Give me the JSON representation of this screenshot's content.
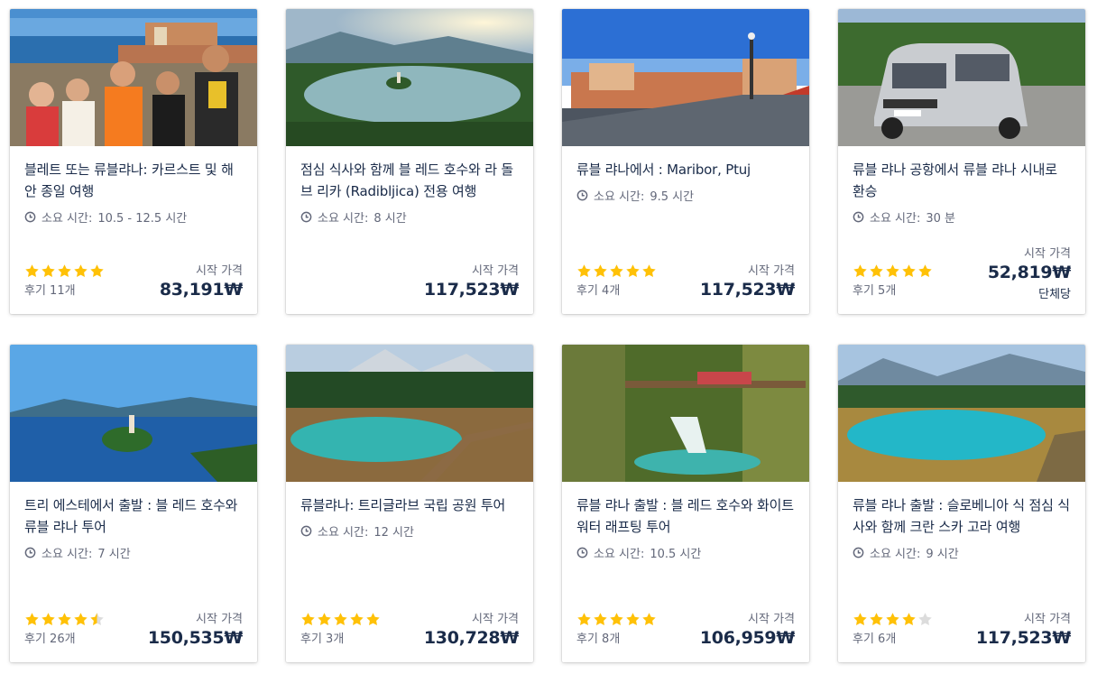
{
  "cards": [
    {
      "title": "블레트 또는 류블랴나: 카르스트 및 해안 종일 여행",
      "duration_label": "소요 시간:",
      "duration": "10.5 - 12.5 시간",
      "rating": 5,
      "reviews": "후기 11개",
      "price_from": "시작 가격",
      "price": "83,191₩",
      "price_unit": ""
    },
    {
      "title": "점심 식사와 함께 블 레드 호수와 라 돌브 리카 (Radibljica) 전용 여행",
      "duration_label": "소요 시간:",
      "duration": "8 시간",
      "rating": null,
      "reviews": "",
      "price_from": "시작 가격",
      "price": "117,523₩",
      "price_unit": ""
    },
    {
      "title": "류블 랴나에서 : Maribor, Ptuj",
      "duration_label": "소요 시간:",
      "duration": "9.5 시간",
      "rating": 5,
      "reviews": "후기 4개",
      "price_from": "시작 가격",
      "price": "117,523₩",
      "price_unit": ""
    },
    {
      "title": "류블 랴나 공항에서 류블 랴나 시내로 환승",
      "duration_label": "소요 시간:",
      "duration": "30 분",
      "rating": 5,
      "reviews": "후기 5개",
      "price_from": "시작 가격",
      "price": "52,819₩",
      "price_unit": "단체당"
    },
    {
      "title": "트리 에스테에서 출발 : 블 레드 호수와 류블 랴나 투어",
      "duration_label": "소요 시간:",
      "duration": "7 시간",
      "rating": 4.5,
      "reviews": "후기 26개",
      "price_from": "시작 가격",
      "price": "150,535₩",
      "price_unit": ""
    },
    {
      "title": "류블랴나: 트리글라브 국립 공원 투어",
      "duration_label": "소요 시간:",
      "duration": "12 시간",
      "rating": 5,
      "reviews": "후기 3개",
      "price_from": "시작 가격",
      "price": "130,728₩",
      "price_unit": ""
    },
    {
      "title": "류블 랴나 출발 : 블 레드 호수와 화이트 워터 래프팅 투어",
      "duration_label": "소요 시간:",
      "duration": "10.5 시간",
      "rating": 5,
      "reviews": "후기 8개",
      "price_from": "시작 가격",
      "price": "106,959₩",
      "price_unit": ""
    },
    {
      "title": "류블 랴나 출발 : 슬로베니아 식 점심 식사와 함께 크란 스카 고라 여행",
      "duration_label": "소요 시간:",
      "duration": "9 시간",
      "rating": 4,
      "reviews": "후기 6개",
      "price_from": "시작 가격",
      "price": "117,523₩",
      "price_unit": ""
    }
  ],
  "colors": {
    "star": "#ffc107",
    "star_empty": "#dcdcdc",
    "text": "#1a2b49",
    "muted": "#63687a"
  },
  "icons": {
    "duration": "clock-icon",
    "rating": "star-icon"
  }
}
